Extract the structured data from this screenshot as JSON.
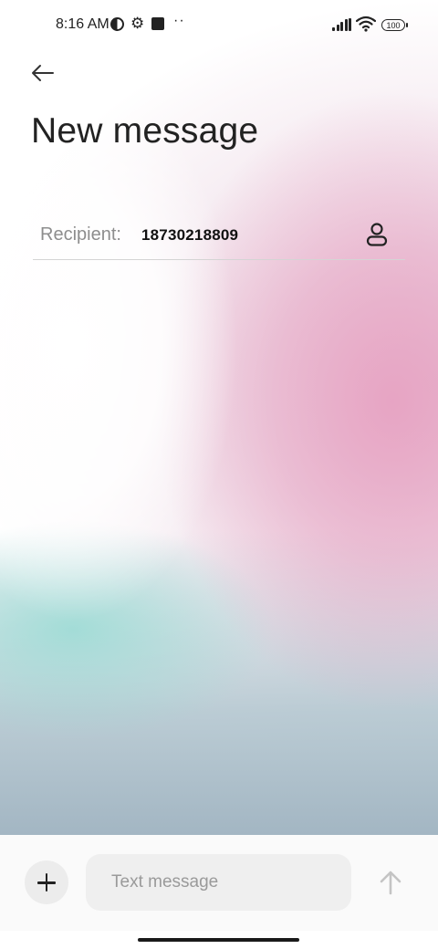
{
  "status_bar": {
    "time": "8:16 AM",
    "battery": "100"
  },
  "header": {
    "title": "New message"
  },
  "recipient": {
    "label": "Recipient:",
    "value": "18730218809"
  },
  "composer": {
    "placeholder": "Text message"
  },
  "icons": {
    "back": "back-arrow-icon",
    "contact": "person-icon",
    "add": "plus-icon",
    "send": "arrow-up-icon"
  }
}
